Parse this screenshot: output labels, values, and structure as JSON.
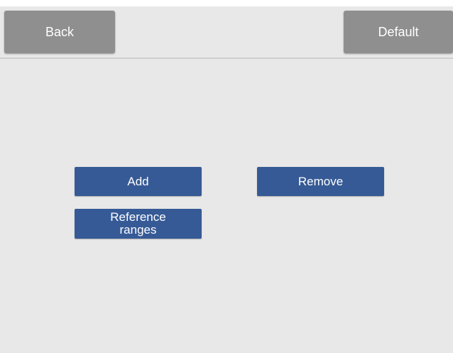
{
  "toolbar": {
    "back_label": "Back",
    "default_label": "Default"
  },
  "actions": {
    "add_label": "Add",
    "remove_label": "Remove",
    "reference_line1": "Reference",
    "reference_line2": "ranges"
  },
  "colors": {
    "background": "#e8e8e8",
    "nav_button": "#8f8f8f",
    "action_button": "#365a96",
    "button_text": "#ffffff"
  }
}
